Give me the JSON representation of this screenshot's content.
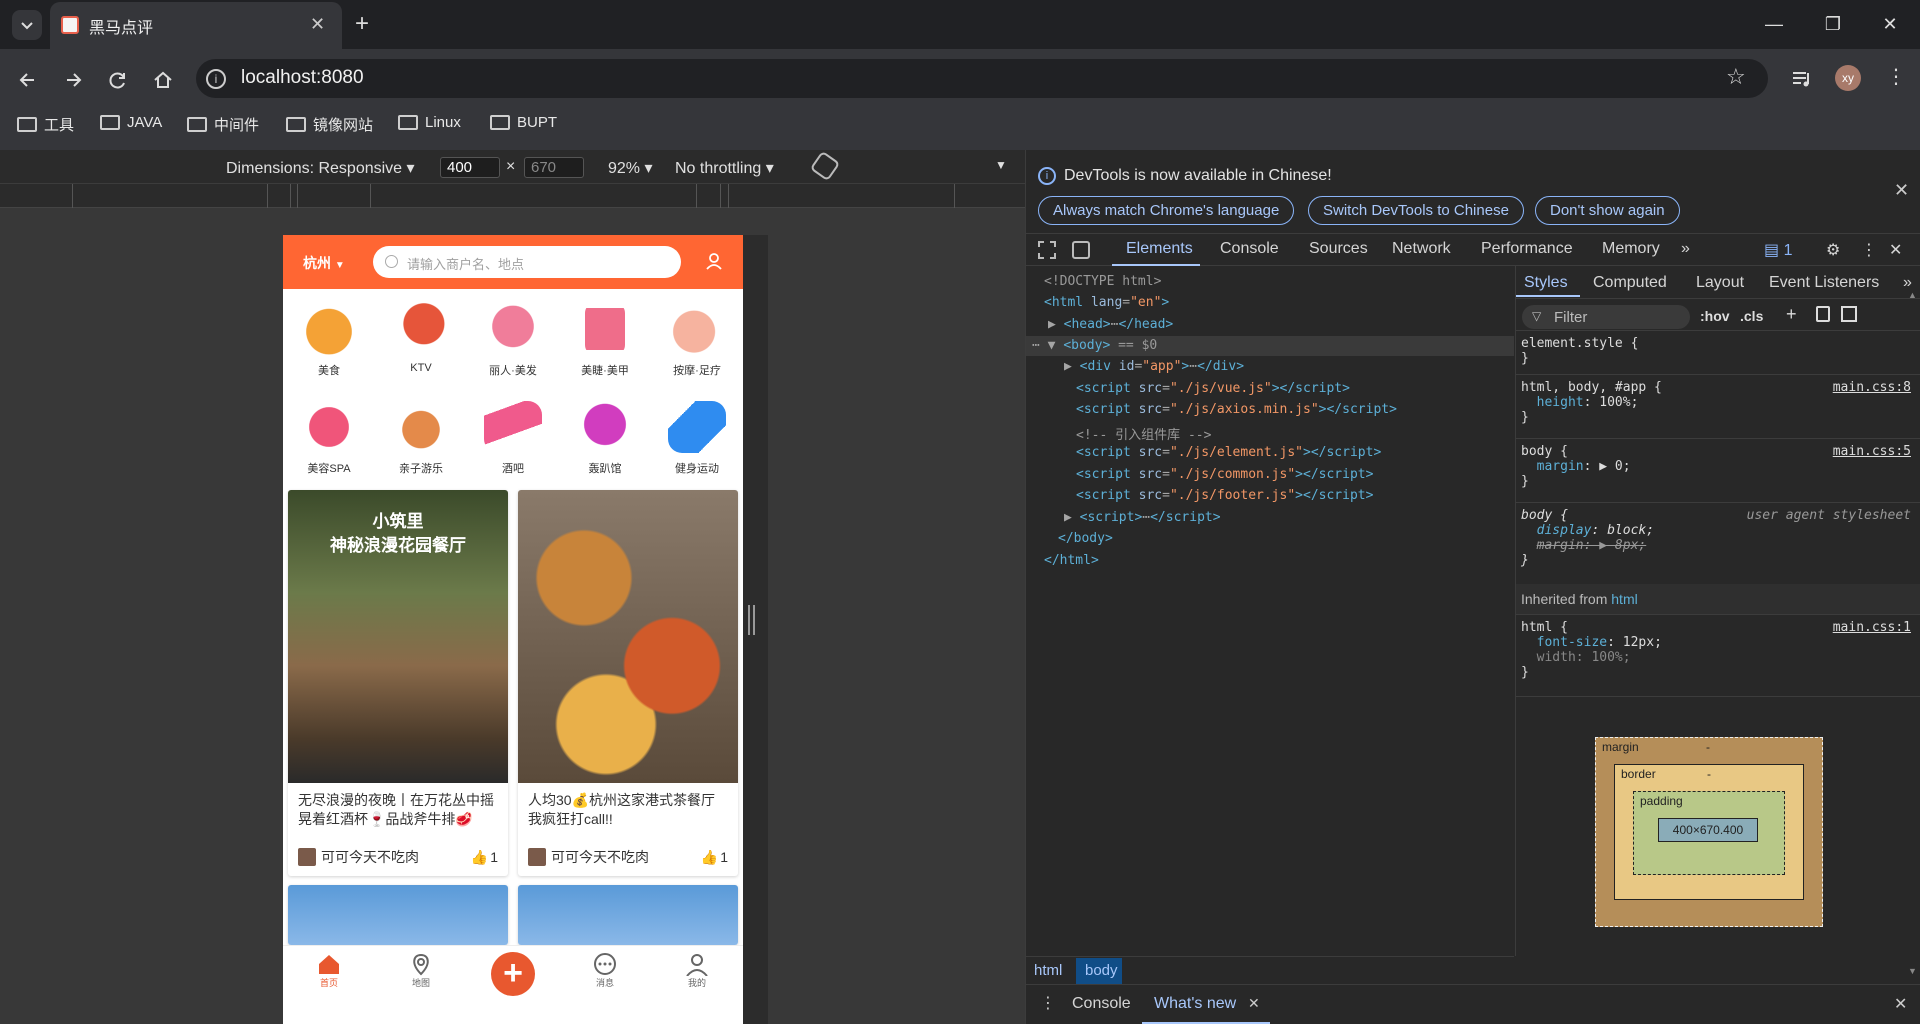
{
  "browser": {
    "tab_title": "黑马点评",
    "url": "localhost:8080",
    "profile_initials": "xy",
    "bookmarks": [
      "工具",
      "JAVA",
      "中间件",
      "镜像网站",
      "Linux",
      "BUPT"
    ]
  },
  "device_toolbar": {
    "dimensions_label": "Dimensions: Responsive",
    "width": "400",
    "height": "670",
    "zoom": "92%",
    "throttling": "No throttling"
  },
  "app": {
    "city": "杭州",
    "search_placeholder": "请输入商户名、地点",
    "categories": [
      {
        "label": "美食",
        "color": "#f4a236",
        "icon": "roast-chicken-icon"
      },
      {
        "label": "KTV",
        "color": "#e6553a",
        "icon": "microphone-icon"
      },
      {
        "label": "丽人·美发",
        "color": "#f07d9a",
        "icon": "hair-icon"
      },
      {
        "label": "美睫·美甲",
        "color": "#ef6d8a",
        "icon": "nail-icon"
      },
      {
        "label": "按摩·足疗",
        "color": "#f6b39f",
        "icon": "foot-icon"
      },
      {
        "label": "美容SPA",
        "color": "#f0557a",
        "icon": "mask-icon"
      },
      {
        "label": "亲子游乐",
        "color": "#e48a4a",
        "icon": "family-icon"
      },
      {
        "label": "酒吧",
        "color": "#f05a8c",
        "icon": "cocktail-icon"
      },
      {
        "label": "轰趴馆",
        "color": "#d13dbf",
        "icon": "party-mask-icon"
      },
      {
        "label": "健身运动",
        "color": "#2f8cf0",
        "icon": "dumbbell-icon"
      }
    ],
    "posts": [
      {
        "title": "无尽浪漫的夜晚丨在万花丛中摇晃着红酒杯🍷品战斧牛排🥩",
        "image_text": "小筑里\n神秘浪漫花园餐厅",
        "author": "可可今天不吃肉",
        "likes": "1"
      },
      {
        "title": "人均30💰杭州这家港式茶餐厅我疯狂打call!!",
        "image_text": "",
        "author": "可可今天不吃肉",
        "likes": "1"
      }
    ],
    "nav": [
      "首页",
      "地图",
      "",
      "消息",
      "我的"
    ]
  },
  "devtools": {
    "banner_text": "DevTools is now available in Chinese!",
    "banner_buttons": [
      "Always match Chrome's language",
      "Switch DevTools to Chinese",
      "Don't show again"
    ],
    "tabs": [
      "Elements",
      "Console",
      "Sources",
      "Network",
      "Performance",
      "Memory"
    ],
    "issues_count": "1",
    "styles_tabs": [
      "Styles",
      "Computed",
      "Layout",
      "Event Listeners"
    ],
    "filter_placeholder": "Filter",
    "hov": ":hov",
    "cls": ".cls",
    "inherited_label": "Inherited from",
    "inherited_from": "html",
    "crumbs": [
      "html",
      "body"
    ],
    "drawer_tabs": [
      "Console",
      "What's new"
    ],
    "box_model": {
      "margin": "margin",
      "border": "border",
      "padding": "padding",
      "content": "400×670.400",
      "dash": "-"
    }
  }
}
